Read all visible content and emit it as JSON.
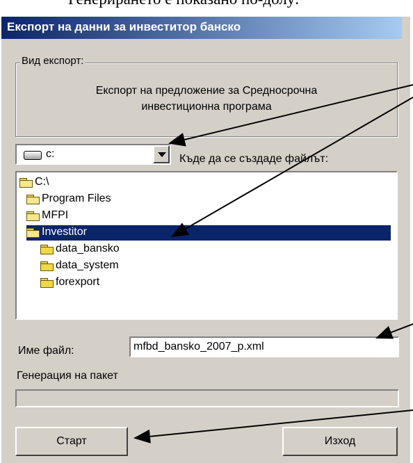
{
  "caption": "Генерирането е показано по-долу:",
  "window": {
    "title": "Експорт на данни за инвеститор банско"
  },
  "export_group": {
    "legend": "Вид експорт:",
    "description_line1": "Експорт на предложение за Средносрочна",
    "description_line2": "инвестиционна програма"
  },
  "drive": {
    "selected": "c:"
  },
  "location_label": "Къде да се създаде файлът:",
  "folders": [
    {
      "label": "C:\\",
      "selected": false
    },
    {
      "label": "Program Files",
      "selected": false
    },
    {
      "label": "MFPI",
      "selected": false
    },
    {
      "label": "Investitor",
      "selected": true
    },
    {
      "label": "data_bansko",
      "selected": false
    },
    {
      "label": "data_system",
      "selected": false
    },
    {
      "label": "forexport",
      "selected": false
    }
  ],
  "filename": {
    "label": "Име файл:",
    "value": "mfbd_bansko_2007_p.xml"
  },
  "progress": {
    "label": "Генерация на пакет",
    "value": 0
  },
  "buttons": {
    "start": "Старт",
    "exit": "Изход"
  },
  "colors": {
    "titlebar": "#0a246a",
    "selection": "#0a246a",
    "dialog_bg": "#d4d0c8"
  }
}
